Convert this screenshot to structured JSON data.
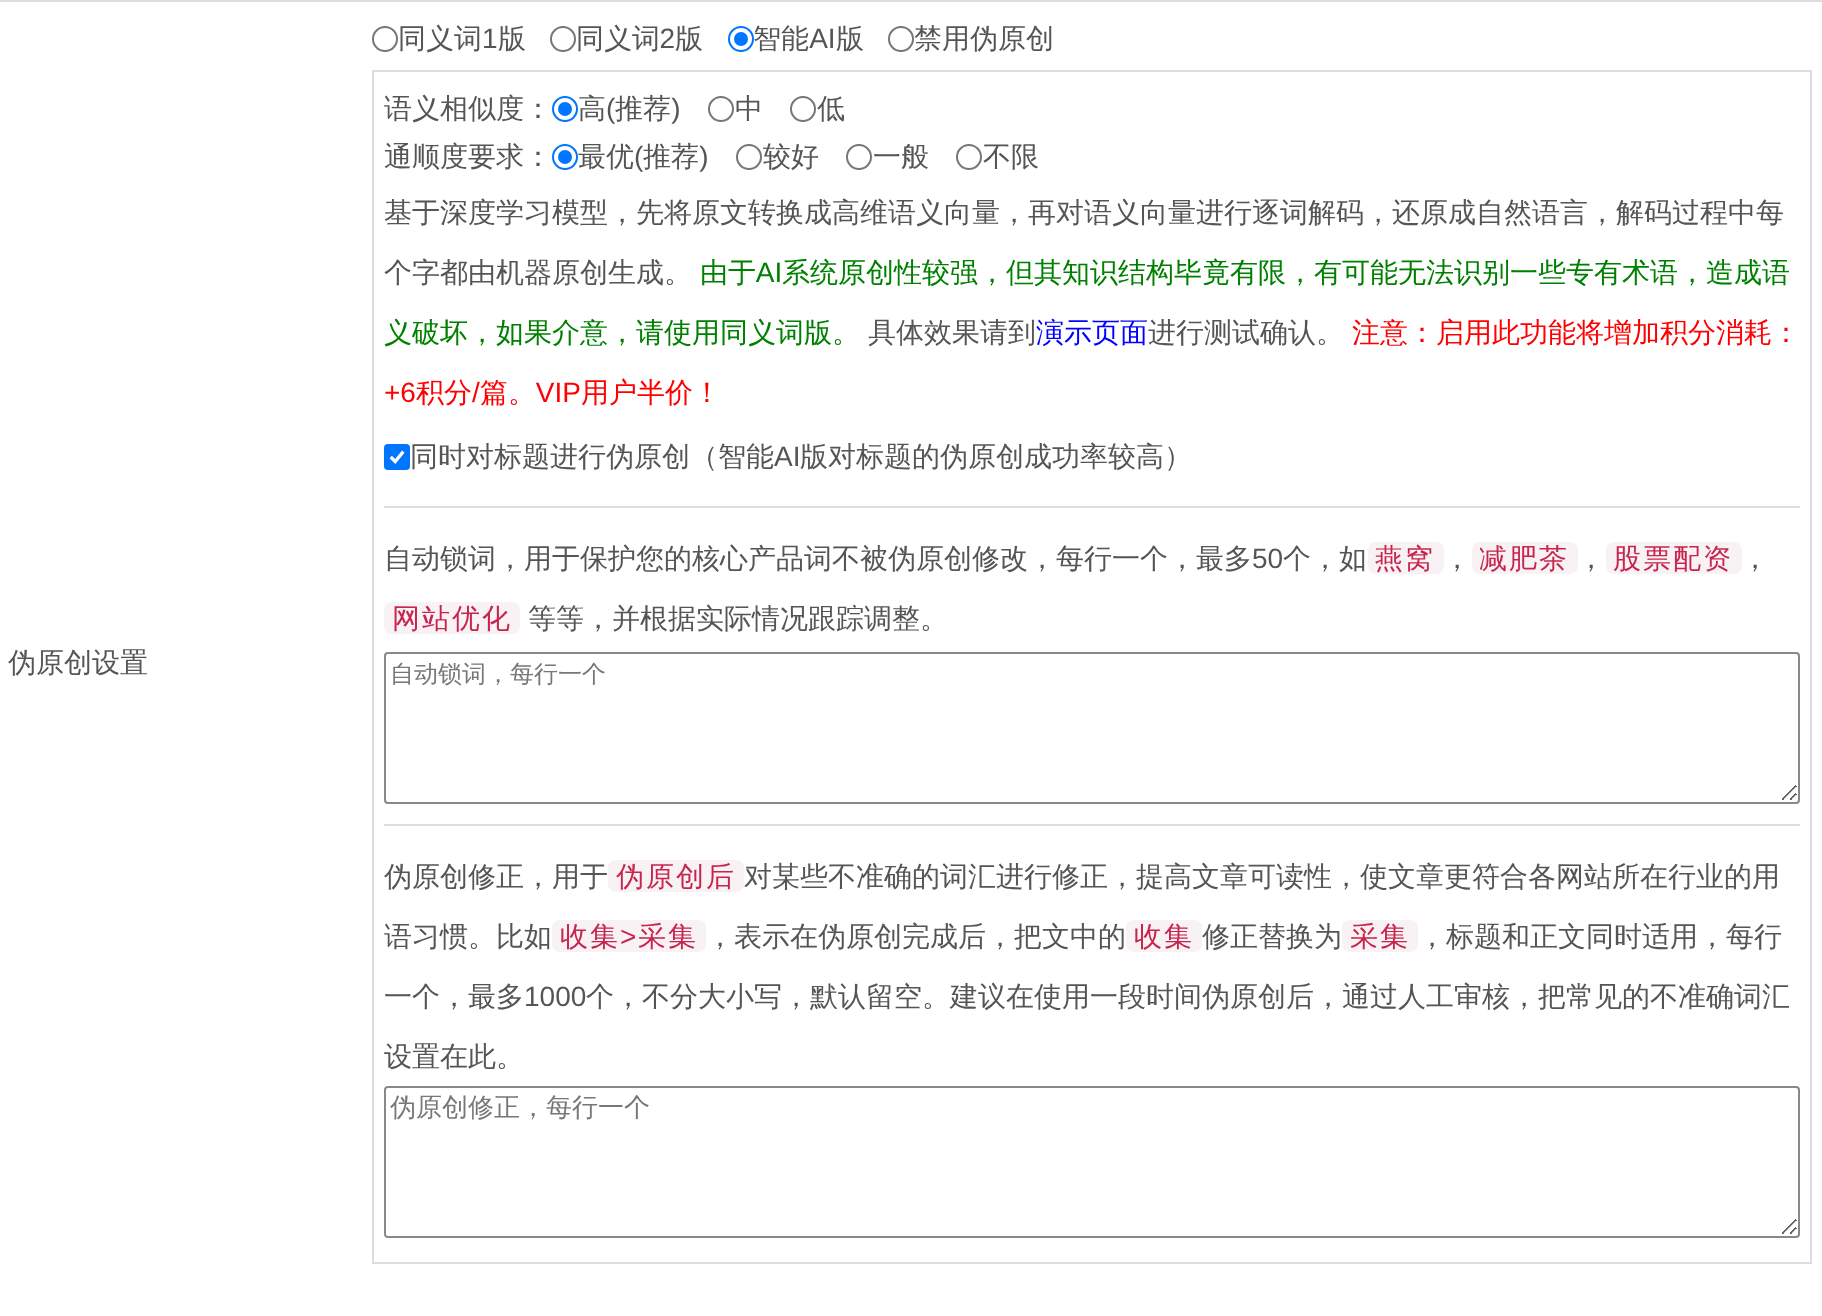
{
  "section_label": "伪原创设置",
  "modes": [
    {
      "label": "同义词1版",
      "selected": false
    },
    {
      "label": "同义词2版",
      "selected": false
    },
    {
      "label": "智能AI版",
      "selected": true
    },
    {
      "label": "禁用伪原创",
      "selected": false
    }
  ],
  "options": [
    {
      "label": "语义相似度：",
      "choices": [
        {
          "label": "高(推荐)",
          "selected": true
        },
        {
          "label": "中",
          "selected": false
        },
        {
          "label": "低",
          "selected": false
        }
      ]
    },
    {
      "label": "通顺度要求：",
      "choices": [
        {
          "label": "最优(推荐)",
          "selected": true
        },
        {
          "label": "较好",
          "selected": false
        },
        {
          "label": "一般",
          "selected": false
        },
        {
          "label": "不限",
          "selected": false
        }
      ]
    }
  ],
  "description": [
    {
      "kind": "plain",
      "text": "基于深度学习模型，先将原文转换成高维语义向量，再对语义向量进行逐词解码，还原成自然语言，解码过程中每个字都由机器原创生成。 "
    },
    {
      "kind": "green",
      "text": "由于AI系统原创性较强，但其知识结构毕竟有限，有可能无法识别一些专有术语，造成语义破坏，如果介意，请使用同义词版。"
    },
    {
      "kind": "plain",
      "text": " 具体效果请到"
    },
    {
      "kind": "link",
      "text": "演示页面"
    },
    {
      "kind": "plain",
      "text": "进行测试确认。 "
    },
    {
      "kind": "red",
      "text": "注意：启用此功能将增加积分消耗：+6积分/篇。VIP用户半价！"
    }
  ],
  "title_option": {
    "label": "同时对标题进行伪原创（智能AI版对标题的伪原创成功率较高）",
    "checked": true
  },
  "lock_words": {
    "description": [
      {
        "kind": "plain",
        "text": "自动锁词，用于保护您的核心产品词不被伪原创修改，每行一个，最多50个，如"
      },
      {
        "kind": "tag",
        "text": "燕窝"
      },
      {
        "kind": "plain",
        "text": "，"
      },
      {
        "kind": "tag",
        "text": "减肥茶"
      },
      {
        "kind": "plain",
        "text": "，"
      },
      {
        "kind": "tag",
        "text": "股票配资"
      },
      {
        "kind": "plain",
        "text": "，"
      },
      {
        "kind": "tag",
        "text": "网站优化"
      },
      {
        "kind": "plain",
        "text": " 等等，并根据实际情况跟踪调整。"
      }
    ],
    "placeholder": "自动锁词，每行一个"
  },
  "corrections": {
    "description": [
      {
        "kind": "plain",
        "text": "伪原创修正，用于"
      },
      {
        "kind": "tag",
        "text": "伪原创后"
      },
      {
        "kind": "plain",
        "text": "对某些不准确的词汇进行修正，提高文章可读性，使文章更符合各网站所在行业的用语习惯。比如"
      },
      {
        "kind": "tag",
        "text": "收集>采集"
      },
      {
        "kind": "plain",
        "text": "，表示在伪原创完成后，把文中的"
      },
      {
        "kind": "tag",
        "text": "收集"
      },
      {
        "kind": "plain",
        "text": "修正替换为"
      },
      {
        "kind": "tag",
        "text": "采集"
      },
      {
        "kind": "plain",
        "text": "，标题和正文同时适用，每行一个，最多1000个，不分大小写，默认留空。建议在使用一段时间伪原创后，通过人工审核，把常见的不准确词汇设置在此。"
      }
    ],
    "placeholder": "伪原创修正，每行一个"
  }
}
